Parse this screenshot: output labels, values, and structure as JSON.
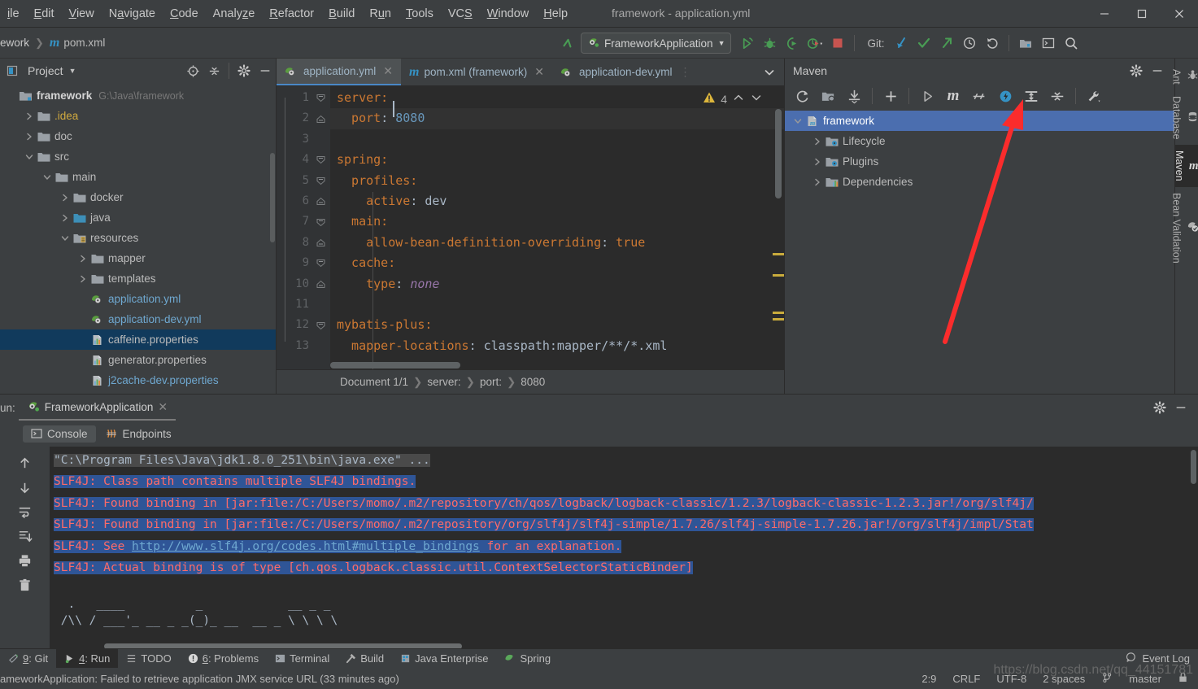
{
  "window": {
    "title": "framework - application.yml",
    "minimize": "minimize-icon",
    "maximize": "maximize-icon",
    "close": "close-icon"
  },
  "menubar": {
    "items": [
      {
        "label": "ile",
        "full": "File"
      },
      {
        "label": "Edit"
      },
      {
        "label": "View"
      },
      {
        "label": "Navigate"
      },
      {
        "label": "Code"
      },
      {
        "label": "Analyze"
      },
      {
        "label": "Refactor"
      },
      {
        "label": "Build"
      },
      {
        "label": "Run"
      },
      {
        "label": "Tools"
      },
      {
        "label": "VCS"
      },
      {
        "label": "Window"
      },
      {
        "label": "Help"
      }
    ]
  },
  "navbar": {
    "breadcrumb": [
      "ework",
      "pom.xml"
    ],
    "run_config": "FrameworkApplication",
    "git_label": "Git:",
    "icons": [
      "run-icon",
      "debug-icon",
      "run-with-coverage-icon",
      "profile-icon",
      "stop-icon",
      "update-project-icon",
      "commit-icon",
      "push-icon",
      "history-icon",
      "rollback-icon",
      "project-structure-icon",
      "terminal-icon",
      "search-everywhere-icon"
    ]
  },
  "project": {
    "title": "Project",
    "head_icons": [
      "locate-icon",
      "collapse-all-icon",
      "settings-icon",
      "hide-icon"
    ],
    "tree": [
      {
        "indent": 0,
        "arrow": "",
        "icon": "module-icon",
        "label": "framework",
        "bold": true,
        "path": "G:\\Java\\framework",
        "color": "normal"
      },
      {
        "indent": 1,
        "arrow": "right",
        "icon": "folder-icon",
        "label": ".idea",
        "color": "yellow"
      },
      {
        "indent": 1,
        "arrow": "right",
        "icon": "folder-icon",
        "label": "doc",
        "color": "normal"
      },
      {
        "indent": 1,
        "arrow": "down",
        "icon": "folder-icon",
        "label": "src",
        "color": "normal"
      },
      {
        "indent": 2,
        "arrow": "down",
        "icon": "folder-icon",
        "label": "main",
        "color": "normal"
      },
      {
        "indent": 3,
        "arrow": "right",
        "icon": "folder-icon",
        "label": "docker",
        "color": "normal"
      },
      {
        "indent": 3,
        "arrow": "right",
        "icon": "source-folder-icon",
        "label": "java",
        "color": "normal"
      },
      {
        "indent": 3,
        "arrow": "down",
        "icon": "resource-folder-icon",
        "label": "resources",
        "color": "normal"
      },
      {
        "indent": 4,
        "arrow": "right",
        "icon": "folder-icon",
        "label": "mapper",
        "color": "normal"
      },
      {
        "indent": 4,
        "arrow": "right",
        "icon": "folder-icon",
        "label": "templates",
        "color": "normal"
      },
      {
        "indent": 4,
        "arrow": "",
        "icon": "spring-yaml-icon",
        "label": "application.yml",
        "color": "blue"
      },
      {
        "indent": 4,
        "arrow": "",
        "icon": "spring-yaml-icon",
        "label": "application-dev.yml",
        "color": "blue"
      },
      {
        "indent": 4,
        "arrow": "",
        "icon": "properties-icon",
        "label": "caffeine.properties",
        "color": "normal",
        "selected": true
      },
      {
        "indent": 4,
        "arrow": "",
        "icon": "properties-icon",
        "label": "generator.properties",
        "color": "normal"
      },
      {
        "indent": 4,
        "arrow": "",
        "icon": "properties-icon",
        "label": "j2cache-dev.properties",
        "color": "blue"
      }
    ]
  },
  "editor": {
    "tabs": [
      {
        "label": "application.yml",
        "icon": "spring-yaml-icon",
        "active": true,
        "closable": true
      },
      {
        "label": "pom.xml (framework)",
        "icon": "maven-icon",
        "active": false,
        "closable": true
      },
      {
        "label": "application-dev.yml",
        "icon": "spring-yaml-icon",
        "active": false,
        "closable": false
      }
    ],
    "tab_overflow_icon": "chevron-down-icon",
    "warning_count": "4",
    "warning_icon": "warning-triangle-icon",
    "prev_icon": "chevron-up-icon",
    "next_icon": "chevron-down-icon",
    "lines": [
      {
        "n": "1",
        "fold": "open",
        "text": "server:",
        "tokens": [
          {
            "t": "server:",
            "c": "k"
          }
        ]
      },
      {
        "n": "2",
        "fold": "end",
        "current": true,
        "tokens": [
          {
            "t": "  port",
            "c": "k"
          },
          {
            "t": ": ",
            "c": "s"
          },
          {
            "t": "8080",
            "c": "v"
          }
        ]
      },
      {
        "n": "3",
        "fold": "",
        "tokens": []
      },
      {
        "n": "4",
        "fold": "open",
        "tokens": [
          {
            "t": "spring:",
            "c": "k"
          }
        ]
      },
      {
        "n": "5",
        "fold": "open",
        "tokens": [
          {
            "t": "  profiles:",
            "c": "k"
          }
        ]
      },
      {
        "n": "6",
        "fold": "end",
        "tokens": [
          {
            "t": "    active",
            "c": "k"
          },
          {
            "t": ": ",
            "c": "s"
          },
          {
            "t": "dev",
            "c": "s"
          }
        ]
      },
      {
        "n": "7",
        "fold": "open",
        "tokens": [
          {
            "t": "  main:",
            "c": "k"
          }
        ]
      },
      {
        "n": "8",
        "fold": "end",
        "tokens": [
          {
            "t": "    allow-bean-definition-overriding",
            "c": "k"
          },
          {
            "t": ": ",
            "c": "s"
          },
          {
            "t": "true",
            "c": "k"
          }
        ]
      },
      {
        "n": "9",
        "fold": "open",
        "tokens": [
          {
            "t": "  cache:",
            "c": "k"
          }
        ]
      },
      {
        "n": "10",
        "fold": "end",
        "tokens": [
          {
            "t": "    type",
            "c": "k"
          },
          {
            "t": ": ",
            "c": "s"
          },
          {
            "t": "none",
            "c": "it"
          }
        ]
      },
      {
        "n": "11",
        "fold": "",
        "tokens": []
      },
      {
        "n": "12",
        "fold": "open",
        "tokens": [
          {
            "t": "mybatis-plus:",
            "c": "k"
          }
        ]
      },
      {
        "n": "13",
        "fold": "",
        "tokens": [
          {
            "t": "  mapper-locations",
            "c": "k"
          },
          {
            "t": ": ",
            "c": "s"
          },
          {
            "t": "classpath:mapper/**/*.xml",
            "c": "s"
          }
        ]
      }
    ],
    "breadcrumb": [
      "Document 1/1",
      "server:",
      "port:",
      "8080"
    ]
  },
  "maven": {
    "title": "Maven",
    "head_icons": [
      "settings-icon",
      "hide-icon"
    ],
    "toolbar_icons": [
      "reload-icon",
      "generate-sources-icon",
      "download-sources-icon",
      "add-maven-project-icon",
      "run-icon",
      "execute-maven-goal-icon",
      "toggle-skip-tests-icon",
      "toggle-offline-icon",
      "expand-all-icon",
      "collapse-all-icon",
      "settings-wrench-icon"
    ],
    "tree": [
      {
        "indent": 0,
        "arrow": "down",
        "icon": "maven-project-icon",
        "label": "framework",
        "selected": true
      },
      {
        "indent": 1,
        "arrow": "right",
        "icon": "lifecycle-icon",
        "label": "Lifecycle"
      },
      {
        "indent": 1,
        "arrow": "right",
        "icon": "plugins-icon",
        "label": "Plugins"
      },
      {
        "indent": 1,
        "arrow": "right",
        "icon": "dependencies-icon",
        "label": "Dependencies"
      }
    ]
  },
  "right_strip": {
    "tabs": [
      {
        "label": "Ant",
        "icon": "ant-icon",
        "active": false
      },
      {
        "label": "Database",
        "icon": "database-icon",
        "active": false
      },
      {
        "label": "Maven",
        "icon": "maven-m-icon",
        "active": true
      },
      {
        "label": "Bean Validation",
        "icon": "bean-validation-icon",
        "active": false
      }
    ]
  },
  "run_panel": {
    "label": "un:",
    "tab_label": "FrameworkApplication",
    "tab_icon": "spring-boot-run-icon",
    "close_icon": "close-icon",
    "settings_icon": "settings-icon",
    "hide_icon": "hide-icon",
    "subtabs": [
      {
        "label": "Console",
        "icon": "console-icon",
        "active": true
      },
      {
        "label": "Endpoints",
        "icon": "endpoints-icon",
        "active": false
      }
    ],
    "toolbar_icons": [
      "up-icon",
      "down-icon",
      "soft-wrap-icon",
      "scroll-to-end-icon",
      "print-icon",
      "clear-all-icon"
    ],
    "console_lines": [
      {
        "text": "\"C:\\Program Files\\Java\\jdk1.8.0_251\\bin\\java.exe\" ...",
        "style": "cmd"
      },
      {
        "text": "SLF4J: Class path contains multiple SLF4J bindings.",
        "style": "err-hl"
      },
      {
        "text": "SLF4J: Found binding in [jar:file:/C:/Users/momo/.m2/repository/ch/qos/logback/logback-classic/1.2.3/logback-classic-1.2.3.jar!/org/slf4j/",
        "style": "err-hl"
      },
      {
        "text": "SLF4J: Found binding in [jar:file:/C:/Users/momo/.m2/repository/org/slf4j/slf4j-simple/1.7.26/slf4j-simple-1.7.26.jar!/org/slf4j/impl/Stat",
        "style": "err-hl"
      },
      {
        "text": "SLF4J: See http://www.slf4j.org/codes.html#multiple_bindings for an explanation.",
        "style": "err-hl-link",
        "link": "http://www.slf4j.org/codes.html#multiple_bindings",
        "pre": "SLF4J: See ",
        "post": " for an explanation."
      },
      {
        "text": "SLF4J: Actual binding is of type [ch.qos.logback.classic.util.ContextSelectorStaticBinder]",
        "style": "err-hl"
      }
    ],
    "banner_lines": [
      "  .   ____          _            __ _ _",
      " /\\\\ / ___'_ __ _ _(_)_ __  __ _ \\ \\ \\ \\"
    ]
  },
  "tool_windows": {
    "items": [
      {
        "label": "9: Git",
        "underline": "9",
        "icon": "git-icon",
        "active": false
      },
      {
        "label": "4: Run",
        "underline": "4",
        "icon": "run-green-icon",
        "active": true
      },
      {
        "label": "TODO",
        "icon": "todo-icon",
        "active": false
      },
      {
        "label": "6: Problems",
        "underline": "6",
        "icon": "problems-icon",
        "active": false
      },
      {
        "label": "Terminal",
        "icon": "terminal-icon",
        "active": false
      },
      {
        "label": "Build",
        "icon": "build-hammer-icon",
        "active": false
      },
      {
        "label": "Java Enterprise",
        "icon": "java-enterprise-icon",
        "active": false
      },
      {
        "label": "Spring",
        "icon": "spring-leaf-icon",
        "active": false
      }
    ],
    "event_log": "Event Log",
    "event_log_icon": "event-log-icon"
  },
  "statusbar": {
    "message": "ameworkApplication: Failed to retrieve application JMX service URL (33 minutes ago)",
    "caret": "2:9",
    "line_sep": "CRLF",
    "encoding": "UTF-8",
    "indent": "2 spaces",
    "branch": "master",
    "branch_icon": "git-branch-icon",
    "lock_icon": "lock-icon"
  },
  "watermark": "https://blog.csdn.net/qq_44151781",
  "colors": {
    "bg": "#3c3f41",
    "editor_bg": "#2b2b2b",
    "accent_blue": "#4b6eaf",
    "select_blue": "#113a5c",
    "error_red": "#ff6b68",
    "console_select": "#2f5597",
    "arrow_red": "#fb2c2c",
    "key_orange": "#cc7832",
    "value_blue": "#6897bb"
  }
}
